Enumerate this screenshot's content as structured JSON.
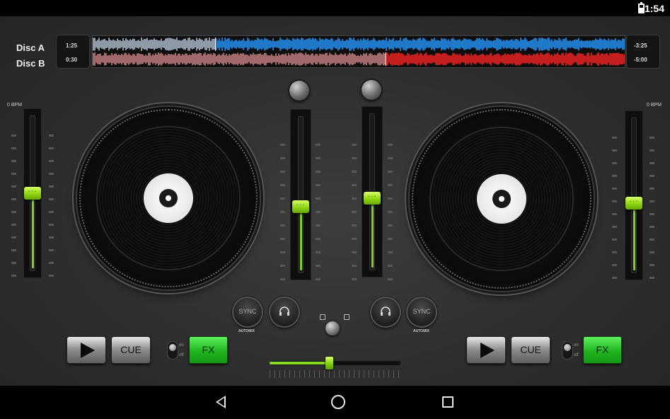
{
  "status_bar": {
    "time": "1:54",
    "battery_icon": "battery-charging-icon"
  },
  "waveform": {
    "deck_a": {
      "label": "Disc A",
      "elapsed": "1:25",
      "remaining": "-3:25",
      "progress": 0.23,
      "played_color": "#8e9aa6",
      "color": "#1f78c8"
    },
    "deck_b": {
      "label": "Disc B",
      "elapsed": "0:30",
      "remaining": "-5:00",
      "progress": 0.55,
      "played_color": "#a06a6a",
      "color": "#c41e1e"
    }
  },
  "deck_left": {
    "bpm_label": "0 BPM",
    "pitch_value": 0.5,
    "volume_value": 0.42,
    "sync_label": "SYNC",
    "automix_label": "AUTOMIX",
    "cue_label": "CUE",
    "fx_label": "FX",
    "toggle_on": "on",
    "toggle_off": "off"
  },
  "deck_right": {
    "bpm_label": "0 BPM",
    "pitch_value": 0.45,
    "volume_value": 0.46,
    "sync_label": "SYNC",
    "automix_label": "AUTOMIX",
    "cue_label": "CUE",
    "fx_label": "FX",
    "toggle_on": "on",
    "toggle_off": "off"
  },
  "crossfader": {
    "value": 0.45
  },
  "colors": {
    "accent": "#88d921",
    "fx_green": "#22c022"
  },
  "nav_icons": [
    "back-icon",
    "home-icon",
    "recent-apps-icon"
  ]
}
